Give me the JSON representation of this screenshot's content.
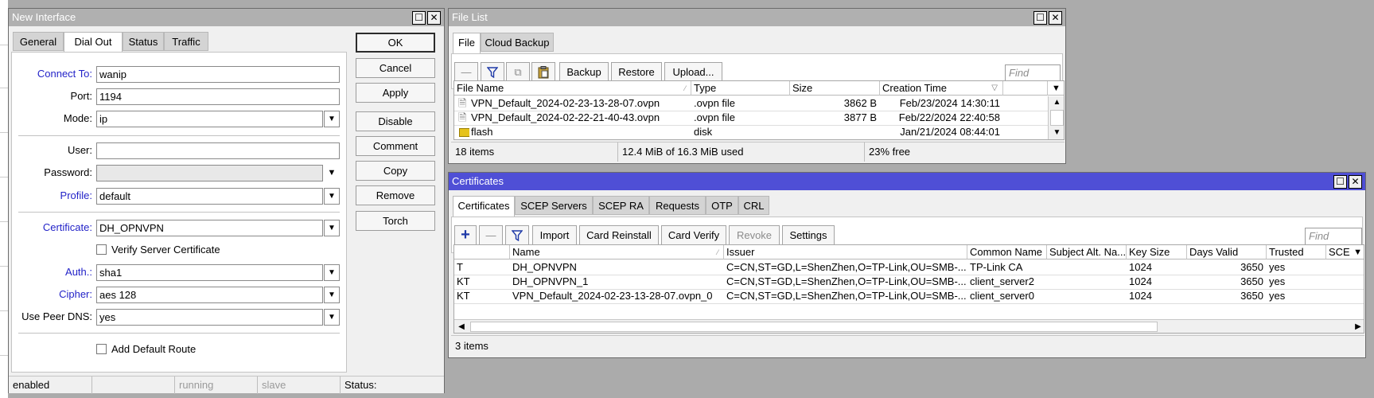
{
  "new_interface": {
    "title": "New Interface",
    "tabs": [
      "General",
      "Dial Out",
      "Status",
      "Traffic"
    ],
    "fields": {
      "connect_to_label": "Connect To:",
      "connect_to": "wanip",
      "port_label": "Port:",
      "port": "1194",
      "mode_label": "Mode:",
      "mode": "ip",
      "user_label": "User:",
      "user": "",
      "password_label": "Password:",
      "password": "",
      "profile_label": "Profile:",
      "profile": "default",
      "certificate_label": "Certificate:",
      "certificate": "DH_OPNVPN",
      "verify_server_cert": "Verify Server Certificate",
      "auth_label": "Auth.:",
      "auth": "sha1",
      "cipher_label": "Cipher:",
      "cipher": "aes 128",
      "use_peer_dns_label": "Use Peer DNS:",
      "use_peer_dns": "yes",
      "add_default_route": "Add Default Route"
    },
    "buttons": [
      "OK",
      "Cancel",
      "Apply",
      "Disable",
      "Comment",
      "Copy",
      "Remove",
      "Torch"
    ],
    "status": {
      "state": "enabled",
      "running": "running",
      "slave": "slave",
      "status_label": "Status:"
    }
  },
  "file_list": {
    "title": "File List",
    "tabs": [
      "File",
      "Cloud Backup"
    ],
    "toolbar": {
      "backup": "Backup",
      "restore": "Restore",
      "upload": "Upload...",
      "find_placeholder": "Find"
    },
    "columns": [
      "File Name",
      "Type",
      "Size",
      "Creation Time"
    ],
    "rows": [
      {
        "name": "VPN_Default_2024-02-23-13-28-07.ovpn",
        "type": ".ovpn file",
        "size": "3862 B",
        "time": "Feb/23/2024 14:30:11"
      },
      {
        "name": "VPN_Default_2024-02-22-21-40-43.ovpn",
        "type": ".ovpn file",
        "size": "3877 B",
        "time": "Feb/22/2024 22:40:58"
      },
      {
        "name": "flash",
        "type": "disk",
        "size": "",
        "time": "Jan/21/2024 08:44:01"
      }
    ],
    "status": {
      "items": "18 items",
      "usage": "12.4 MiB of 16.3 MiB used",
      "free": "23% free"
    }
  },
  "certificates": {
    "title": "Certificates",
    "tabs": [
      "Certificates",
      "SCEP Servers",
      "SCEP RA",
      "Requests",
      "OTP",
      "CRL"
    ],
    "toolbar": {
      "import": "Import",
      "card_reinstall": "Card Reinstall",
      "card_verify": "Card Verify",
      "revoke": "Revoke",
      "settings": "Settings",
      "find_placeholder": "Find"
    },
    "columns": [
      "",
      "Name",
      "Issuer",
      "Common Name",
      "Subject Alt. Na...",
      "Key Size",
      "Days Valid",
      "Trusted",
      "SCE"
    ],
    "rows": [
      {
        "flags": "T",
        "name": "DH_OPNVPN",
        "issuer": "C=CN,ST=GD,L=ShenZhen,O=TP-Link,OU=SMB-...",
        "cn": "TP-Link CA",
        "san": "",
        "key": "1024",
        "days": "3650",
        "trusted": "yes"
      },
      {
        "flags": "KT",
        "name": "DH_OPNVPN_1",
        "issuer": "C=CN,ST=GD,L=ShenZhen,O=TP-Link,OU=SMB-...",
        "cn": "client_server2",
        "san": "",
        "key": "1024",
        "days": "3650",
        "trusted": "yes"
      },
      {
        "flags": "KT",
        "name": "VPN_Default_2024-02-23-13-28-07.ovpn_0",
        "issuer": "C=CN,ST=GD,L=ShenZhen,O=TP-Link,OU=SMB-...",
        "cn": "client_server0",
        "san": "",
        "key": "1024",
        "days": "3650",
        "trusted": "yes"
      }
    ],
    "status": {
      "items": "3 items"
    }
  },
  "icons": [
    "maximize-icon",
    "close-icon",
    "dropdown-arrow-icon",
    "filter-icon",
    "minus-icon",
    "plus-icon",
    "copy-icon",
    "paste-icon",
    "file-icon",
    "folder-icon",
    "scroll-up-icon",
    "scroll-down-icon",
    "scroll-left-icon",
    "scroll-right-icon"
  ],
  "colors": {
    "active_title": "#4f4fd6",
    "inactive_title": "#b0b0b0",
    "label_blue": "#2323c8",
    "folder_yellow": "#e6c31c",
    "plus_blue": "#1f3aa8"
  }
}
